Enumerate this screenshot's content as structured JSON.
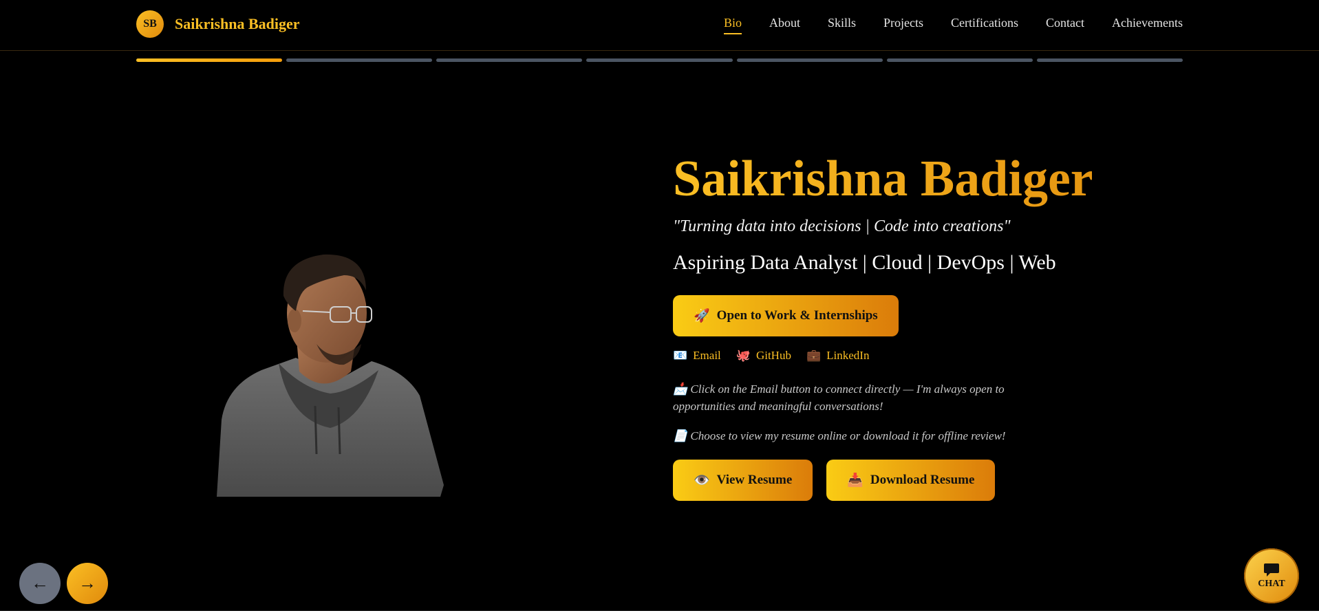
{
  "brand": {
    "initials": "SB",
    "name": "Saikrishna Badiger"
  },
  "nav": {
    "items": [
      {
        "label": "Bio",
        "active": true
      },
      {
        "label": "About",
        "active": false
      },
      {
        "label": "Skills",
        "active": false
      },
      {
        "label": "Projects",
        "active": false
      },
      {
        "label": "Certifications",
        "active": false
      },
      {
        "label": "Contact",
        "active": false
      },
      {
        "label": "Achievements",
        "active": false
      }
    ]
  },
  "progress": {
    "current_section": 1,
    "total_sections": 7
  },
  "hero": {
    "name": "Saikrishna Badiger",
    "tagline": "\"Turning data into decisions | Code into creations\"",
    "role": "Aspiring Data Analyst | Cloud | DevOps | Web",
    "open_button": {
      "icon": "🚀",
      "label": "Open to Work & Internships"
    },
    "social_links": [
      {
        "icon": "📧",
        "label": "Email"
      },
      {
        "icon": "🐙",
        "label": "GitHub"
      },
      {
        "icon": "💼",
        "label": "LinkedIn"
      }
    ],
    "email_note": {
      "icon": "📩",
      "text": "Click on the Email button to connect directly — I'm always open to opportunities and meaningful conversations!"
    },
    "resume_note": {
      "icon": "📄",
      "text": "Choose to view my resume online or download it for offline review!"
    },
    "view_resume": {
      "icon": "👁️",
      "label": "View Resume"
    },
    "download_resume": {
      "icon": "📥",
      "label": "Download Resume"
    }
  },
  "controls": {
    "prev_arrow": "←",
    "next_arrow": "→",
    "chat_label": "CHAT"
  },
  "colors": {
    "accent": "#fbbf24",
    "accent_dark": "#e08a0c",
    "background": "#000000",
    "inactive_segment": "#4b5563"
  }
}
